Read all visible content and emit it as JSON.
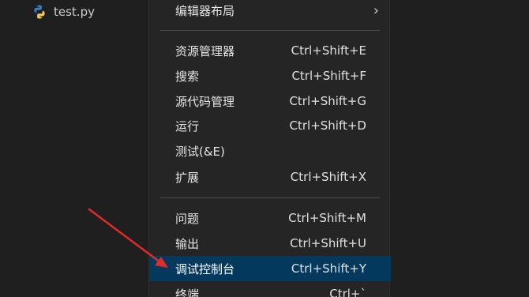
{
  "explorer": {
    "file_name": "test.py",
    "file_icon": "python-icon"
  },
  "menu": {
    "top_item": {
      "label": "编辑器布局",
      "has_submenu": true
    },
    "group1": [
      {
        "label": "资源管理器",
        "shortcut": "Ctrl+Shift+E"
      },
      {
        "label": "搜索",
        "shortcut": "Ctrl+Shift+F"
      },
      {
        "label": "源代码管理",
        "shortcut": "Ctrl+Shift+G"
      },
      {
        "label": "运行",
        "shortcut": "Ctrl+Shift+D"
      },
      {
        "label": "测试(&E)",
        "shortcut": ""
      },
      {
        "label": "扩展",
        "shortcut": "Ctrl+Shift+X"
      }
    ],
    "group2": [
      {
        "label": "问题",
        "shortcut": "Ctrl+Shift+M"
      },
      {
        "label": "输出",
        "shortcut": "Ctrl+Shift+U"
      },
      {
        "label": "调试控制台",
        "shortcut": "Ctrl+Shift+Y",
        "selected": true
      },
      {
        "label": "终端",
        "shortcut": "Ctrl+`"
      }
    ]
  },
  "colors": {
    "background": "#1f1f1f",
    "menu_background": "#252526",
    "selected_background": "#04395e",
    "annotation_arrow": "#e02b2b",
    "python_blue": "#3b78b5",
    "python_yellow": "#f2c94c"
  }
}
